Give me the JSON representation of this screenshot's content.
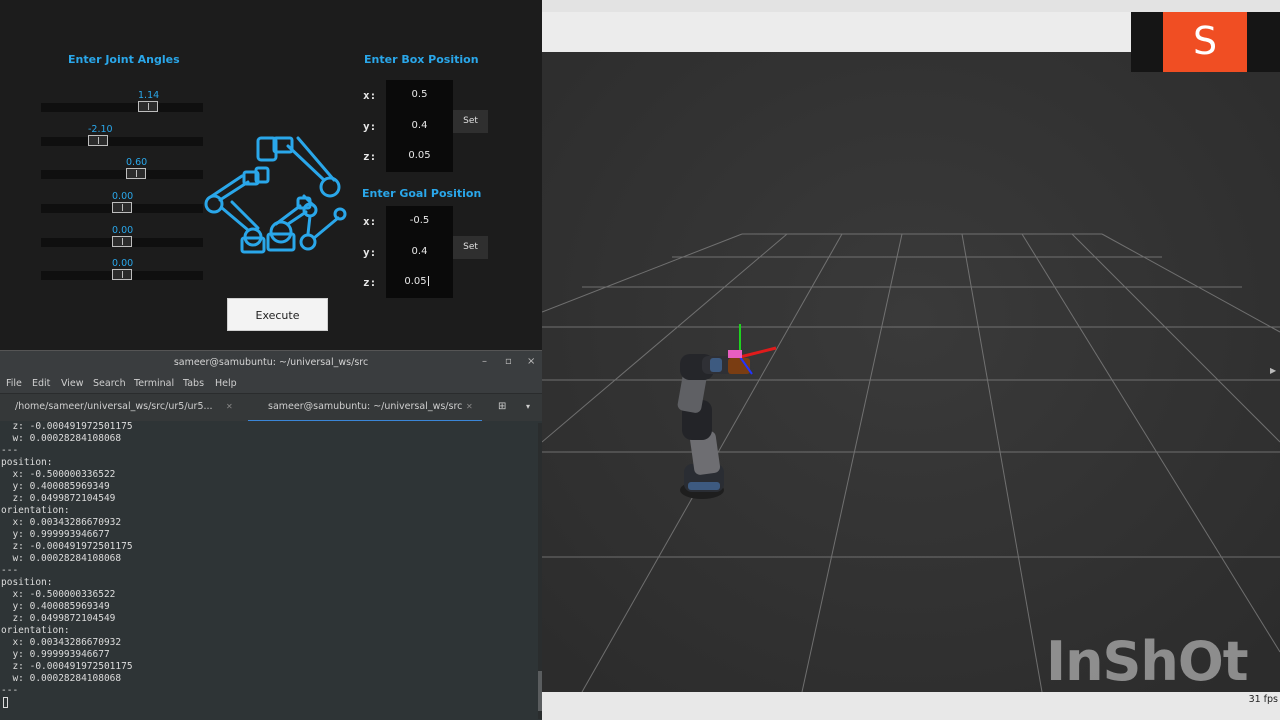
{
  "panel": {
    "joint_heading": "Enter Joint Angles",
    "box_heading": "Enter Box Position",
    "goal_heading": "Enter Goal Position",
    "joints": [
      {
        "value_label": "1.14",
        "value": 1.14
      },
      {
        "value_label": "-2.10",
        "value": -2.1
      },
      {
        "value_label": "0.60",
        "value": 0.6
      },
      {
        "value_label": "0.00",
        "value": 0.0
      },
      {
        "value_label": "0.00",
        "value": 0.0
      },
      {
        "value_label": "0.00",
        "value": 0.0
      }
    ],
    "box": {
      "x_label": "x:",
      "y_label": "y:",
      "z_label": "z:",
      "x": "0.5",
      "y": "0.4",
      "z": "0.05",
      "set_label": "Set"
    },
    "goal": {
      "x_label": "x:",
      "y_label": "y:",
      "z_label": "z:",
      "x": "-0.5",
      "y": "0.4",
      "z": "0.05",
      "set_label": "Set"
    },
    "execute_label": "Execute",
    "accent_color": "#2aa7ea"
  },
  "terminal": {
    "title": "sameer@samubuntu: ~/universal_ws/src",
    "menu": [
      "File",
      "Edit",
      "View",
      "Search",
      "Terminal",
      "Tabs",
      "Help"
    ],
    "tabs": [
      {
        "label": "/home/sameer/universal_ws/src/ur5/ur5...",
        "active": false
      },
      {
        "label": "sameer@samubuntu: ~/universal_ws/src",
        "active": true
      }
    ],
    "lines": [
      "  z: -0.000491972501175",
      "  w: 0.00028284108068",
      "---",
      "position:",
      "  x: -0.500000336522",
      "  y: 0.400085969349",
      "  z: 0.0499872104549",
      "orientation:",
      "  x: 0.00343286670932",
      "  y: 0.999993946677",
      "  z: -0.000491972501175",
      "  w: 0.00028284108068",
      "---",
      "position:",
      "  x: -0.500000336522",
      "  y: 0.400085969349",
      "  z: 0.0499872104549",
      "orientation:",
      "  x: 0.00343286670932",
      "  y: 0.999993946677",
      "  z: -0.000491972501175",
      "  w: 0.00028284108068",
      "---"
    ]
  },
  "viewport": {
    "fps_label": "31 fps",
    "brand_letter": "S",
    "watermark": "InShOt"
  }
}
